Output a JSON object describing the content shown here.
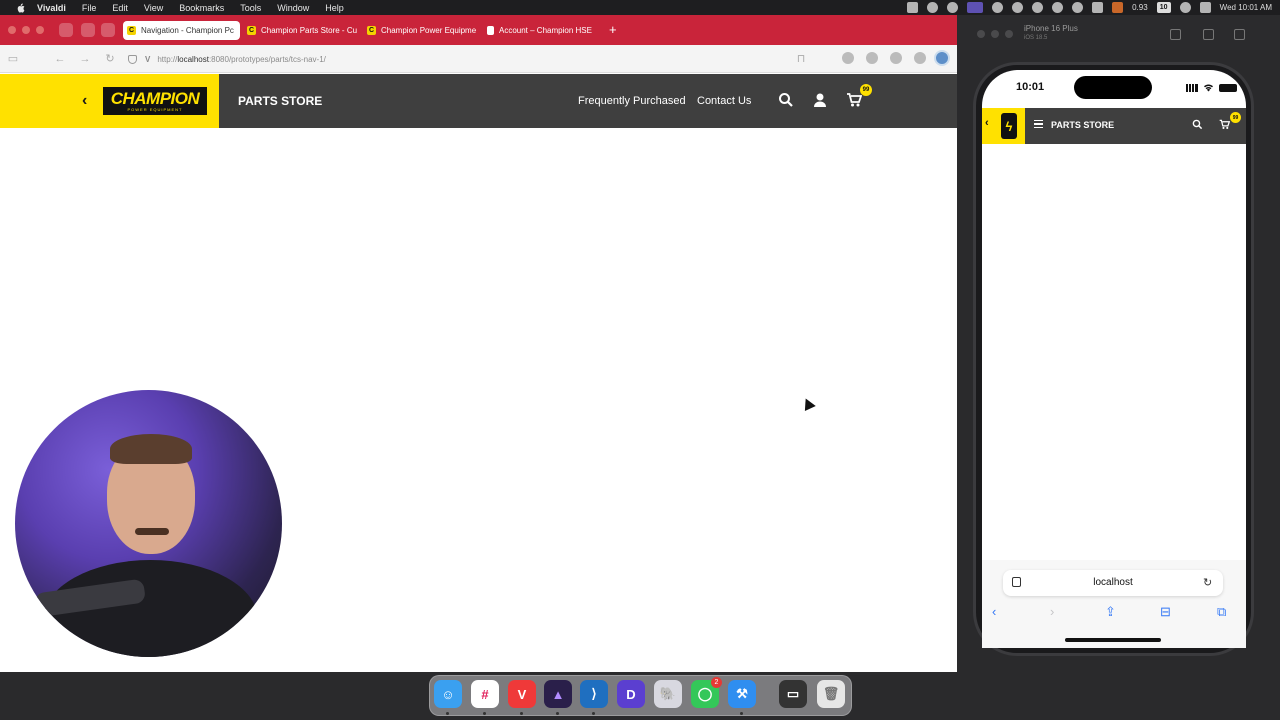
{
  "menubar": {
    "app": "Vivaldi",
    "items": [
      "File",
      "Edit",
      "View",
      "Bookmarks",
      "Tools",
      "Window",
      "Help"
    ],
    "status_value": "0.93",
    "badge": "10",
    "clock": "Wed 10:01 AM"
  },
  "browser": {
    "tabs": [
      {
        "label": "Navigation - Champion Pc",
        "active": true
      },
      {
        "label": "Champion Parts Store - Cu",
        "active": false
      },
      {
        "label": "Champion Power Equipme",
        "active": false
      },
      {
        "label": "Account – Champion HSE",
        "active": false
      }
    ],
    "new_tab": "+",
    "url_v": "V",
    "url_prefix": "http://",
    "url_host": "localhost",
    "url_rest": ":8080/prototypes/parts/tcs-nav-1/"
  },
  "site": {
    "logo_word": "CHAMPION",
    "logo_sub": "POWER EQUIPMENT",
    "store_title": "PARTS STORE",
    "nav": [
      "Frequently Purchased",
      "Contact Us"
    ],
    "cart_count": "99",
    "colors": {
      "brand_yellow": "#ffe100",
      "header_dark": "#3f3f3f",
      "tab_red": "#c9243a"
    }
  },
  "dock": {
    "items": [
      "finder-icon",
      "slack-icon",
      "vivaldi-icon",
      "affinity-icon",
      "vscode-icon",
      "d-app-icon",
      "tableplus-icon",
      "messages-icon",
      "xcode-icon",
      "simulator-icon",
      "trash-icon"
    ],
    "messages_badge": "2"
  },
  "simulator": {
    "device": "iPhone 16 Plus",
    "os": "iOS 18.5",
    "time": "10:01",
    "store_title": "PARTS STORE",
    "cart_count": "99",
    "url": "localhost"
  }
}
